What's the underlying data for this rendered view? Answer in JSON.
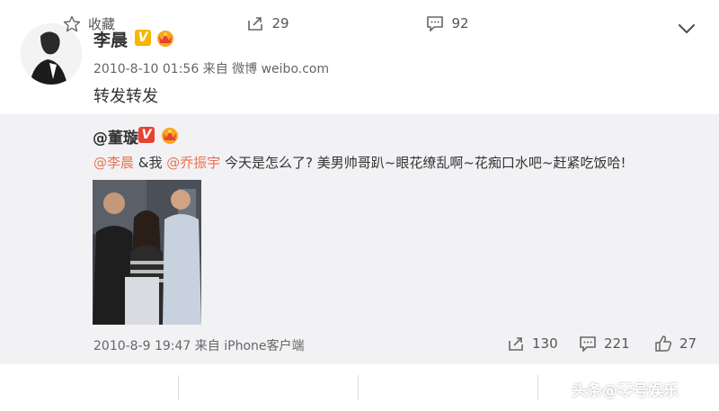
{
  "post": {
    "author": "李晨",
    "meta": "2010-8-10 01:56 来自 微博 weibo.com",
    "content": "转发转发"
  },
  "repost": {
    "author": "@董璇",
    "text_mention1": "@李晨",
    "text_mid": " &我 ",
    "text_mention2": "@乔振宇",
    "text_body": " 今天是怎么了? 美男帅哥趴~眼花缭乱啊~花痴口水吧~赶紧吃饭哈!",
    "meta": "2010-8-9 19:47 来自 iPhone客户端",
    "repost_count": "130",
    "comment_count": "221",
    "like_count": "27"
  },
  "actions": {
    "favorite_label": "收藏",
    "repost_count": "29",
    "comment_count": "92"
  },
  "watermark": "头条@零号娱乐",
  "colors": {
    "mention": "#eb7350",
    "repost_bg": "#f2f2f5",
    "v_badge": "#f7b500"
  },
  "icons": [
    "verified-v-icon",
    "member-crown-icon",
    "chevron-down-icon",
    "share-icon",
    "comment-icon",
    "like-icon",
    "star-icon"
  ]
}
